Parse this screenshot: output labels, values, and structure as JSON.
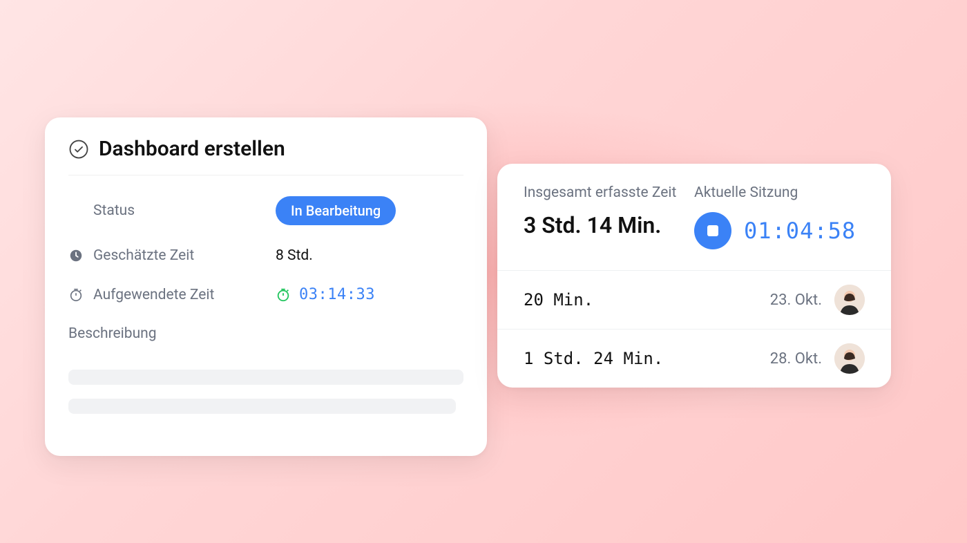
{
  "task": {
    "title": "Dashboard erstellen",
    "status_label": "Status",
    "status_value": "In Bearbeitung",
    "estimated_label": "Geschätzte Zeit",
    "estimated_value": "8 Std.",
    "spent_label": "Aufgewendete Zeit",
    "spent_value": "03:14:33",
    "description_label": "Beschreibung"
  },
  "tracking": {
    "total_label": "Insgesamt erfasste Zeit",
    "total_value": "3 Std. 14 Min.",
    "session_label": "Aktuelle Sitzung",
    "session_value": "01:04:58",
    "entries": [
      {
        "duration": "20 Min.",
        "date": "23. Okt."
      },
      {
        "duration": "1 Std. 24 Min.",
        "date": "28. Okt."
      }
    ]
  }
}
